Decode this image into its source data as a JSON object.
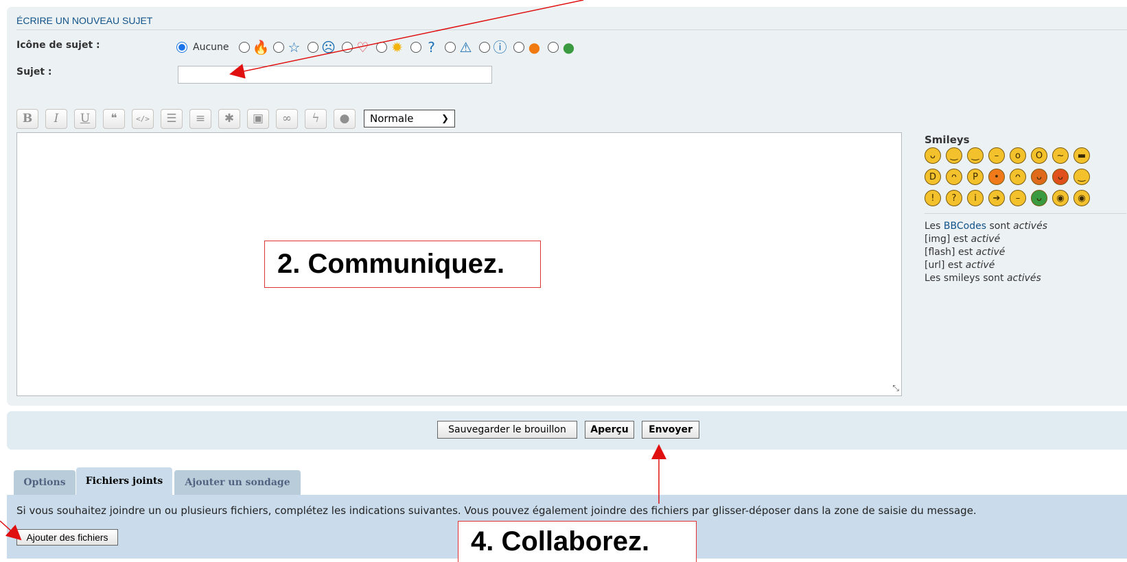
{
  "panel": {
    "title": "ÉCRIRE UN NOUVEAU SUJET",
    "topic_icon_label": "Icône de sujet :",
    "none_label": "Aucune",
    "subject_label": "Sujet :",
    "subject_value": ""
  },
  "topic_icons": [
    {
      "name": "fire-icon",
      "glyph": "🔥",
      "color": "#f08a24"
    },
    {
      "name": "star-icon",
      "glyph": "☆",
      "color": "#1c6fb5"
    },
    {
      "name": "sad-face-icon",
      "glyph": "☹",
      "color": "#1c6fb5"
    },
    {
      "name": "heart-icon",
      "glyph": "♡",
      "color": "#e0303a"
    },
    {
      "name": "lightbulb-icon",
      "glyph": "✹",
      "color": "#f2b40c"
    },
    {
      "name": "question-icon",
      "glyph": "?",
      "color": "#1c6fb5"
    },
    {
      "name": "warning-icon",
      "glyph": "⚠",
      "color": "#1c6fb5"
    },
    {
      "name": "info-icon",
      "glyph": "ⓘ",
      "color": "#1c6fb5"
    },
    {
      "name": "orange-face-icon",
      "glyph": "●",
      "color": "#f07a10"
    },
    {
      "name": "green-face-icon",
      "glyph": "●",
      "color": "#3a9a40"
    }
  ],
  "toolbar": {
    "buttons": [
      {
        "name": "bold-button",
        "glyph": "B"
      },
      {
        "name": "italic-button",
        "glyph": "I"
      },
      {
        "name": "underline-button",
        "glyph": "U"
      },
      {
        "name": "quote-button",
        "glyph": "❝"
      },
      {
        "name": "code-button",
        "glyph": "</>"
      },
      {
        "name": "list-button",
        "glyph": "☰"
      },
      {
        "name": "ordered-list-button",
        "glyph": "≡"
      },
      {
        "name": "list-item-button",
        "glyph": "✱"
      },
      {
        "name": "image-button",
        "glyph": "▣"
      },
      {
        "name": "link-button",
        "glyph": "∞"
      },
      {
        "name": "flash-button",
        "glyph": "ϟ"
      },
      {
        "name": "color-button",
        "glyph": "●"
      }
    ],
    "size_value": "Normale"
  },
  "smileys": {
    "title": "Smileys",
    "items": [
      {
        "name": "smiley-grin",
        "color": "#f3c12b",
        "glyph": "ᴗ"
      },
      {
        "name": "smiley-smile",
        "color": "#f3c12b",
        "glyph": "‿"
      },
      {
        "name": "smiley-wink",
        "color": "#f3c12b",
        "glyph": "‿"
      },
      {
        "name": "smiley-neutral",
        "color": "#f3c12b",
        "glyph": "–"
      },
      {
        "name": "smiley-surprised",
        "color": "#f3c12b",
        "glyph": "o"
      },
      {
        "name": "smiley-eek",
        "color": "#f3c12b",
        "glyph": "O"
      },
      {
        "name": "smiley-confused",
        "color": "#f3c12b",
        "glyph": "~"
      },
      {
        "name": "smiley-cool",
        "color": "#f3c12b",
        "glyph": "▬"
      },
      {
        "name": "smiley-lol",
        "color": "#f3c12b",
        "glyph": "D"
      },
      {
        "name": "smiley-mad",
        "color": "#f3c12b",
        "glyph": "ᴖ"
      },
      {
        "name": "smiley-razz",
        "color": "#f3c12b",
        "glyph": "P"
      },
      {
        "name": "smiley-redface",
        "color": "#f07a1a",
        "glyph": "•"
      },
      {
        "name": "smiley-cry",
        "color": "#f3c12b",
        "glyph": "ᴖ"
      },
      {
        "name": "smiley-evil",
        "color": "#e06a1c",
        "glyph": "ᴗ"
      },
      {
        "name": "smiley-twisted",
        "color": "#e0501c",
        "glyph": "ᴗ"
      },
      {
        "name": "smiley-rolleyes",
        "color": "#f3c12b",
        "glyph": "‿"
      },
      {
        "name": "smiley-exclaim",
        "color": "#f3c12b",
        "glyph": "!"
      },
      {
        "name": "smiley-question",
        "color": "#f3c12b",
        "glyph": "?"
      },
      {
        "name": "smiley-idea",
        "color": "#f3c12b",
        "glyph": "i"
      },
      {
        "name": "smiley-arrow",
        "color": "#f3c12b",
        "glyph": "➔"
      },
      {
        "name": "smiley-neutral-2",
        "color": "#f3c12b",
        "glyph": "–"
      },
      {
        "name": "smiley-green",
        "color": "#3a9a40",
        "glyph": "ᴗ"
      },
      {
        "name": "smiley-geek",
        "color": "#f3c12b",
        "glyph": "◉"
      },
      {
        "name": "smiley-ugeek",
        "color": "#f3c12b",
        "glyph": "◉"
      }
    ]
  },
  "bbinfo": {
    "l1_pre": "Les ",
    "l1_link": "BBCodes",
    "l1_mid": " sont ",
    "l1_state": "activés",
    "l2_pre": "[img] est ",
    "l2_state": "activé",
    "l3_pre": "[flash] est ",
    "l3_state": "activé",
    "l4_pre": "[url] est ",
    "l4_state": "activé",
    "l5_pre": "Les smileys sont ",
    "l5_state": "activés"
  },
  "actions": {
    "save_draft": "Sauvegarder le brouillon",
    "preview": "Aperçu",
    "submit": "Envoyer"
  },
  "tabs": {
    "options": "Options",
    "attachments": "Fichiers joints",
    "poll": "Ajouter un sondage"
  },
  "attachments": {
    "info": "Si vous souhaitez joindre un ou plusieurs fichiers, complétez les indications suivantes. Vous pouvez également joindre des fichiers par glisser-déposer dans la zone de saisie du message.",
    "add_button": "Ajouter des fichiers"
  },
  "annotations": {
    "callout_2": "2. Communiquez.",
    "callout_4": "4. Collaborez.",
    "arrow_color": "#e01010"
  }
}
